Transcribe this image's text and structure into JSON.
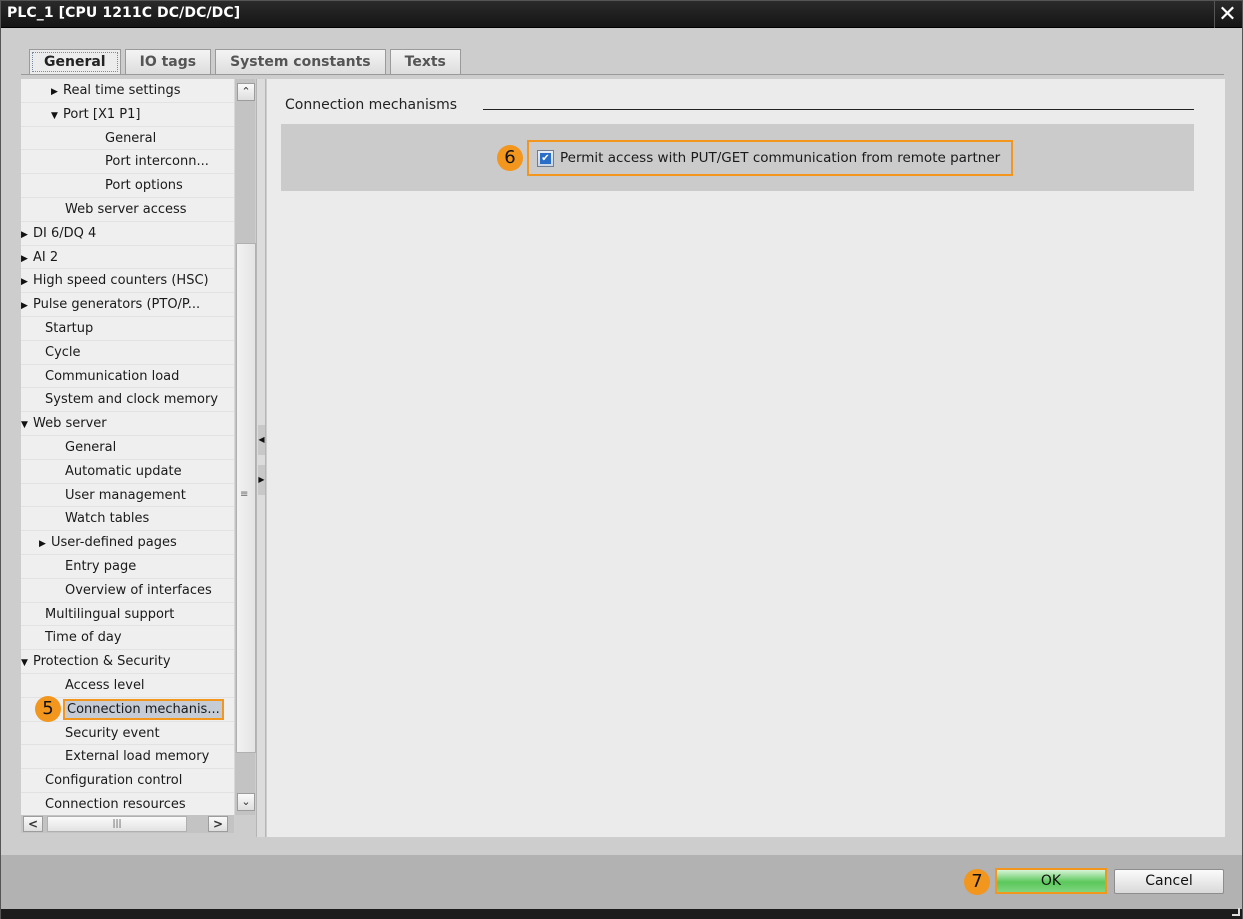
{
  "window": {
    "title": "PLC_1 [CPU 1211C DC/DC/DC]",
    "close_glyph": "✕"
  },
  "tabs": [
    {
      "label": "General",
      "active": true
    },
    {
      "label": "IO tags",
      "active": false
    },
    {
      "label": "System constants",
      "active": false
    },
    {
      "label": "Texts",
      "active": false
    }
  ],
  "tree": {
    "items": [
      {
        "label": "Real time settings",
        "level": 2,
        "arrow": "▶"
      },
      {
        "label": "Port [X1 P1]",
        "level": 2,
        "arrow": "▼"
      },
      {
        "label": "General",
        "level": 3,
        "arrow": ""
      },
      {
        "label": "Port interconn...",
        "level": 3,
        "arrow": ""
      },
      {
        "label": "Port options",
        "level": 3,
        "arrow": ""
      },
      {
        "label": "Web server access",
        "level": 2,
        "arrow": ""
      },
      {
        "label": "DI 6/DQ 4",
        "level": 0,
        "arrow": "▶"
      },
      {
        "label": "AI 2",
        "level": 0,
        "arrow": "▶"
      },
      {
        "label": "High speed counters (HSC)",
        "level": 0,
        "arrow": "▶"
      },
      {
        "label": "Pulse generators (PTO/P...",
        "level": 0,
        "arrow": "▶"
      },
      {
        "label": "Startup",
        "level": 1,
        "arrow": ""
      },
      {
        "label": "Cycle",
        "level": 1,
        "arrow": ""
      },
      {
        "label": "Communication load",
        "level": 1,
        "arrow": ""
      },
      {
        "label": "System and clock memory",
        "level": 1,
        "arrow": ""
      },
      {
        "label": "Web server",
        "level": 0,
        "arrow": "▼"
      },
      {
        "label": "General",
        "level": 2,
        "arrow": ""
      },
      {
        "label": "Automatic update",
        "level": 2,
        "arrow": ""
      },
      {
        "label": "User management",
        "level": 2,
        "arrow": ""
      },
      {
        "label": "Watch tables",
        "level": 2,
        "arrow": ""
      },
      {
        "label": "User-defined pages",
        "level": 1.5,
        "arrow": "▶"
      },
      {
        "label": "Entry page",
        "level": 2,
        "arrow": ""
      },
      {
        "label": "Overview of interfaces",
        "level": 2,
        "arrow": ""
      },
      {
        "label": "Multilingual support",
        "level": 1,
        "arrow": ""
      },
      {
        "label": "Time of day",
        "level": 1,
        "arrow": ""
      },
      {
        "label": "Protection & Security",
        "level": 0,
        "arrow": "▼"
      },
      {
        "label": "Access level",
        "level": 2,
        "arrow": ""
      },
      {
        "label": "Connection mechanis...",
        "level": 2,
        "arrow": "",
        "selected": true
      },
      {
        "label": "Security event",
        "level": 2,
        "arrow": ""
      },
      {
        "label": "External load memory",
        "level": 2,
        "arrow": ""
      },
      {
        "label": "Configuration control",
        "level": 1,
        "arrow": ""
      },
      {
        "label": "Connection resources",
        "level": 1,
        "arrow": ""
      }
    ],
    "scroll_up": "⌃",
    "scroll_down": "⌄",
    "scroll_left": "<",
    "scroll_right": ">",
    "hthumb_grip": "|||",
    "vthumb_grip": "≡"
  },
  "content": {
    "section_title": "Connection mechanisms",
    "option": {
      "label": "Permit access with PUT/GET communication from remote partner",
      "checked": true,
      "check_glyph": "✔"
    }
  },
  "annotations": {
    "step5": "5",
    "step6": "6",
    "step7": "7",
    "highlight_color": "#f2961e"
  },
  "footer": {
    "ok_label": "OK",
    "cancel_label": "Cancel"
  }
}
